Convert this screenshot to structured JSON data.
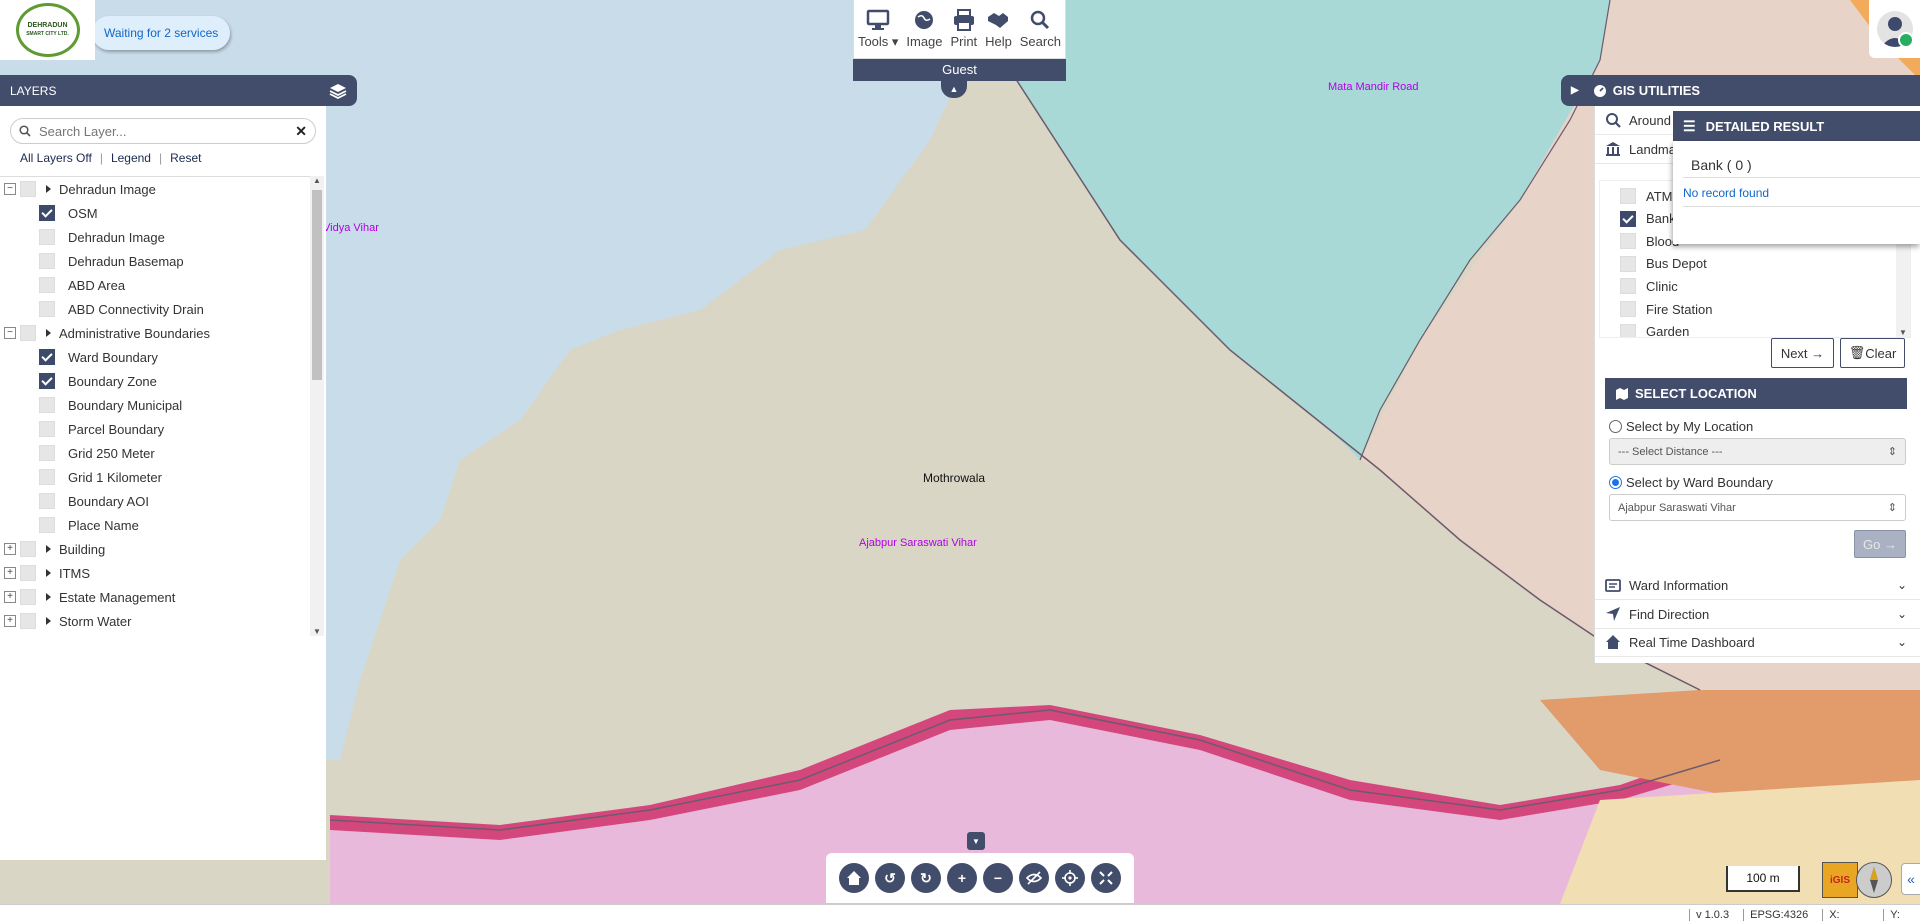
{
  "logo": {
    "line1": "DEHRADUN",
    "line2": "SMART CITY LTD."
  },
  "status_pill": "Waiting for 2 services",
  "toolbar": {
    "items": [
      {
        "label": "Tools",
        "icon": "monitor-icon"
      },
      {
        "label": "Image",
        "icon": "globe-icon"
      },
      {
        "label": "Print",
        "icon": "printer-icon"
      },
      {
        "label": "Help",
        "icon": "handshake-icon"
      },
      {
        "label": "Search",
        "icon": "search-icon"
      }
    ],
    "user_role": "Guest"
  },
  "map": {
    "labels": [
      "Vidya Vihar",
      "Mata Mandir Road",
      "Mothrowala",
      "Ajabpur Saraswati Vihar"
    ]
  },
  "layers": {
    "title": "LAYERS",
    "search_placeholder": "Search Layer...",
    "links": [
      "All Layers Off",
      "Legend",
      "Reset"
    ],
    "tree": [
      {
        "label": "Dehradun Image",
        "group": true,
        "expanded": true
      },
      {
        "label": "OSM",
        "checked": true
      },
      {
        "label": "Dehradun Image",
        "checked": false
      },
      {
        "label": "Dehradun Basemap",
        "checked": false
      },
      {
        "label": "ABD Area",
        "checked": false
      },
      {
        "label": "ABD Connectivity Drain",
        "checked": false
      },
      {
        "label": "Administrative Boundaries",
        "group": true,
        "expanded": true
      },
      {
        "label": "Ward Boundary",
        "checked": true
      },
      {
        "label": "Boundary Zone",
        "checked": true
      },
      {
        "label": "Boundary Municipal",
        "checked": false
      },
      {
        "label": "Parcel Boundary",
        "checked": false
      },
      {
        "label": "Grid 250 Meter",
        "checked": false
      },
      {
        "label": "Grid 1 Kilometer",
        "checked": false
      },
      {
        "label": "Boundary AOI",
        "checked": false
      },
      {
        "label": "Place Name",
        "checked": false
      },
      {
        "label": "Building",
        "group": true,
        "expanded": false
      },
      {
        "label": "ITMS",
        "group": true,
        "expanded": false
      },
      {
        "label": "Estate Management",
        "group": true,
        "expanded": false
      },
      {
        "label": "Storm Water",
        "group": true,
        "expanded": false
      }
    ]
  },
  "gis": {
    "title": "GIS UTILITIES",
    "around_label": "Around",
    "landmark_label": "Landma",
    "landmarks": [
      {
        "label": "ATM",
        "checked": false
      },
      {
        "label": "Bank",
        "checked": true
      },
      {
        "label": "Blood",
        "checked": false
      },
      {
        "label": "Bus Depot",
        "checked": false
      },
      {
        "label": "Clinic",
        "checked": false
      },
      {
        "label": "Fire Station",
        "checked": false
      },
      {
        "label": "Garden",
        "checked": false
      }
    ],
    "next_label": "Next",
    "clear_label": "Clear",
    "select_location": {
      "title": "SELECT LOCATION",
      "by_my_location": "Select by My Location",
      "distance_value": "--- Select Distance ---",
      "by_ward": "Select by Ward Boundary",
      "ward_value": "Ajabpur Saraswati Vihar",
      "go_label": "Go"
    },
    "sections": [
      "Ward Information",
      "Find Direction",
      "Real Time Dashboard"
    ]
  },
  "detail": {
    "title": "DETAILED RESULT",
    "result_title": "Bank ( 0 )",
    "message": "No record found"
  },
  "scale": "100 m",
  "brand_logo_text": "iGIS",
  "status_bar": {
    "version": "v 1.0.3",
    "epsg": "EPSG:4326",
    "x": "X:",
    "y": "Y:"
  },
  "colors": {
    "accent": "#424d6b",
    "link": "#1167c7",
    "label_purple": "#b100e8"
  }
}
